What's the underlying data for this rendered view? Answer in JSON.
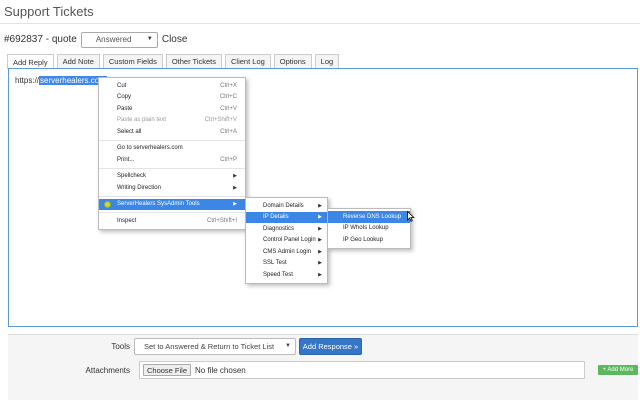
{
  "page": {
    "title": "Support Tickets"
  },
  "ticket": {
    "id_label": "#692837 - quote",
    "status_value": "Answered",
    "close_label": "Close"
  },
  "tabs": [
    {
      "label": "Add Reply",
      "active": true
    },
    {
      "label": "Add Note"
    },
    {
      "label": "Custom Fields"
    },
    {
      "label": "Other Tickets"
    },
    {
      "label": "Client Log"
    },
    {
      "label": "Options"
    },
    {
      "label": "Log"
    }
  ],
  "editor": {
    "prefix_text": "https://",
    "selected_text": "serverhealers.com"
  },
  "context_menu": {
    "items": [
      {
        "label": "Cut",
        "shortcut": "Ctrl+X"
      },
      {
        "label": "Copy",
        "shortcut": "Ctrl+C"
      },
      {
        "label": "Paste",
        "shortcut": "Ctrl+V"
      },
      {
        "label": "Paste as plain text",
        "shortcut": "Ctrl+Shift+V",
        "disabled": true
      },
      {
        "label": "Select all",
        "shortcut": "Ctrl+A"
      },
      {
        "label": "Go to serverhealers.com"
      },
      {
        "label": "Print...",
        "shortcut": "Ctrl+P"
      },
      {
        "label": "Spellcheck"
      },
      {
        "label": "Writing Direction"
      },
      {
        "label": "ServerHealers SysAdmin Tools"
      },
      {
        "label": "Inspect",
        "shortcut": "Ctrl+Shift+I"
      }
    ]
  },
  "submenu_tools": {
    "items": [
      {
        "label": "Domain Details"
      },
      {
        "label": "IP Details"
      },
      {
        "label": "Diagnostics"
      },
      {
        "label": "Control Panel Login"
      },
      {
        "label": "CMS Admin Login"
      },
      {
        "label": "SSL Test"
      },
      {
        "label": "Speed Test"
      }
    ]
  },
  "submenu_ip": {
    "items": [
      {
        "label": "Reverse DNS Lookup"
      },
      {
        "label": "IP WhoIs Lookup"
      },
      {
        "label": "IP Geo Lookup"
      }
    ]
  },
  "footer": {
    "tools_label": "Tools",
    "tools_value": "Set to Answered & Return to Ticket List",
    "add_response_label": "Add Response »",
    "attachments_label": "Attachments",
    "choose_file_label": "Choose File",
    "no_file_text": "No file chosen",
    "add_more_label": "+ Add More"
  },
  "colors": {
    "accent": "#3577c6",
    "menu_highlight": "#3c86e6",
    "add_more": "#5cb85c",
    "editor_border": "#5b9bd5"
  }
}
